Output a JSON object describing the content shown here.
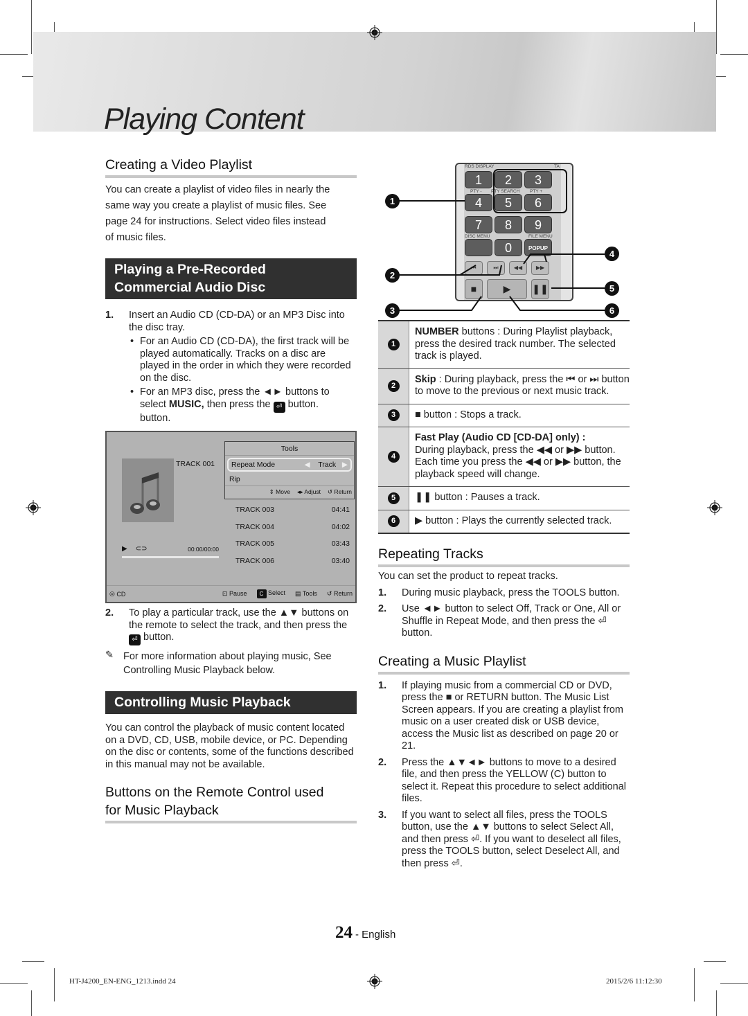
{
  "page_title": "Playing Content",
  "left": {
    "video_playlist": {
      "heading": "Creating a Video Playlist",
      "lines": [
        "You can create a playlist of video files in nearly the",
        "same way you create a playlist of music files. See",
        "page 24 for instructions. Select video files instead",
        "of music files."
      ]
    },
    "audio_disc": {
      "banner_line1": "Playing a Pre-Recorded",
      "banner_line2": "Commercial Audio Disc",
      "step1": {
        "num": "1.",
        "text": "Insert an Audio CD (CD-DA) or an MP3 Disc into the disc tray.",
        "bullet1": "For an Audio CD (CD-DA), the first track will be played automatically. Tracks on a disc are played in the order in which they were recorded on the disc.",
        "bullet2_pre": "For an MP3 disc, press the ◄► buttons to select ",
        "bullet2_bold": "MUSIC,",
        "bullet2_post": " then press the",
        "bullet2_end": "button.",
        "bullet2_extra": "button."
      },
      "screen": {
        "now_playing": "TRACK 001",
        "tools_title": "Tools",
        "tools_items": [
          {
            "label": "Repeat Mode",
            "value": "Track"
          },
          {
            "label": "Rip",
            "value": ""
          }
        ],
        "tools_hints": [
          "⇕ Move",
          "◂▸ Adjust",
          "↺ Return"
        ],
        "tracks": [
          {
            "name": "TRACK 003",
            "time": "04:41"
          },
          {
            "name": "TRACK 004",
            "time": "04:02"
          },
          {
            "name": "TRACK 005",
            "time": "03:43"
          },
          {
            "name": "TRACK 006",
            "time": "03:40"
          }
        ],
        "time": "00:00/00:00",
        "source": "CD",
        "footer": [
          "Pause",
          "Select",
          "Tools",
          "Return"
        ],
        "progress": 0
      },
      "step2": {
        "num": "2.",
        "text": "To play a particular track, use the ▲▼ buttons on the remote to select the track, and then press the",
        "end": "button."
      },
      "note": "For more information about playing music, See Controlling Music Playback below."
    },
    "music_playback": {
      "banner": "Controlling Music Playback",
      "text": "You can control the playback of music content located on a DVD, CD, USB, mobile device, or PC. Depending on the disc or contents, some of the functions described in this manual may not be available.",
      "sub_heading_line1": "Buttons on the Remote Control used",
      "sub_heading_line2": "for Music Playback"
    }
  },
  "remote": {
    "top_labels": [
      "RDS DISPLAY",
      "TA"
    ],
    "keys": [
      "1",
      "2",
      "3",
      "4",
      "5",
      "6",
      "7",
      "8",
      "9",
      "0"
    ],
    "row_labels": [
      "PTY -",
      "PTY SEARCH",
      "PTY +"
    ],
    "disc_menu": "DISC MENU",
    "file_menu": "FILE MENU",
    "popup": "POPUP",
    "callouts": [
      "1",
      "2",
      "3",
      "4",
      "5",
      "6"
    ]
  },
  "button_table": [
    {
      "num": "1",
      "bold": "NUMBER",
      "text": " buttons : During Playlist playback, press the desired track number. The selected track is played."
    },
    {
      "num": "2",
      "bold": "Skip",
      "text": " : During playback, press the ⏮ or ⏭ button to move to the previous or next music track."
    },
    {
      "num": "3",
      "bold": "",
      "text": "■ button : Stops a track."
    },
    {
      "num": "4",
      "bold": "Fast Play (Audio CD [CD-DA] only) :",
      "text": "During playback, press the ◀◀ or ▶▶ button. Each time you press the ◀◀ or ▶▶ button, the playback speed will change."
    },
    {
      "num": "5",
      "bold": "",
      "text": "❚❚ button : Pauses a track."
    },
    {
      "num": "6",
      "bold": "",
      "text": "▶ button : Plays the currently selected track."
    }
  ],
  "repeating": {
    "heading": "Repeating Tracks",
    "intro": "You can set the product to repeat tracks.",
    "steps": [
      {
        "num": "1.",
        "text": "During music playback, press the TOOLS button."
      },
      {
        "num": "2.",
        "text": "Use ◄► button to select Off, Track or One, All or Shuffle in Repeat Mode, and then press the ⏎ button."
      }
    ]
  },
  "music_playlist": {
    "heading": "Creating a Music Playlist",
    "steps": [
      {
        "num": "1.",
        "text": "If playing music from a commercial CD or DVD, press the ■ or RETURN button. The Music List Screen appears. If you are creating a playlist from music on a user created disk or USB device, access the Music list as described on page 20 or 21."
      },
      {
        "num": "2.",
        "text": "Press the ▲▼◄► buttons to move to a desired file, and then press the YELLOW (C) button to select it. Repeat this procedure to select additional files."
      },
      {
        "num": "3.",
        "text": "If you want to select all files, press the TOOLS button, use the ▲▼ buttons to select Select All, and then press ⏎. If you want to deselect all files, press the TOOLS button, select Deselect All, and then press ⏎."
      }
    ]
  },
  "footer": {
    "page_number": "24",
    "language": "- English",
    "slug_file": "HT-J4200_EN-ENG_1213.indd   24",
    "slug_date": "2015/2/6   11:12:30"
  }
}
